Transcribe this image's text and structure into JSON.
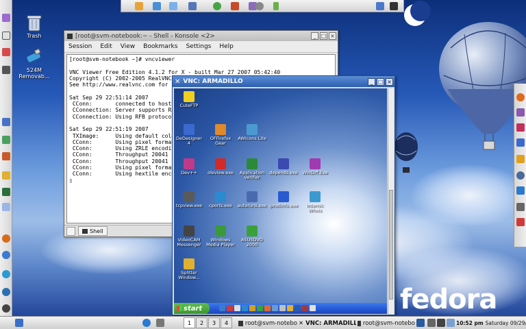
{
  "desktop": {
    "icons": [
      {
        "label": "Trash"
      },
      {
        "label": "524M Removab..."
      }
    ],
    "logo_text": "fedora"
  },
  "konsole": {
    "title": "[root@svm-notebook:~ - Shell - Konsole <2>",
    "menu": [
      "Session",
      "Edit",
      "View",
      "Bookmarks",
      "Settings",
      "Help"
    ],
    "terminal_lines": [
      "[root@svm-notebook ~]# vncviewer",
      "",
      "VNC Viewer Free Edition 4.1.2 for X - built Mar 27 2007 05:42:40",
      "Copyright (C) 2002-2005 RealVNC",
      "See http://www.realvnc.com for i",
      "",
      "Sat Sep 29 22:51:14 2007",
      " CConn:       connected to host",
      " CConnection: Server supports RF",
      " CConnection: Using RFB protocol",
      "",
      "Sat Sep 29 22:51:19 2007",
      " TXImage:     Using default colo",
      " CConn:       Using pixel format",
      " CConn:       Using ZRLE encodin",
      " CConn:       Throughput 20041 k",
      " CConn:       Throughput 20041 k",
      " CConn:       Using pixel format",
      " CConn:       Using hextile enco",
      "▯"
    ],
    "tab_label": "Shell"
  },
  "vnc": {
    "title": "VNC: ARMADILLO",
    "icons": [
      {
        "label": "CuteFTP"
      },
      {
        "label": "DeDesigner 4"
      },
      {
        "label": "OFFirefox Gear"
      },
      {
        "label": "AWIcons Lite"
      },
      {
        "label": "Dev++"
      },
      {
        "label": "oleview.exe"
      },
      {
        "label": "Application Verifier"
      },
      {
        "label": "depends.exe"
      },
      {
        "label": "WinDiff.Exe"
      },
      {
        "label": "tcpview.exe"
      },
      {
        "label": "cports.exe"
      },
      {
        "label": "autoruns.exe"
      },
      {
        "label": "ipnetinfo.exe"
      },
      {
        "label": "Internic Whois"
      },
      {
        "label": "VideoCAM Messenger"
      },
      {
        "label": "Windows Media Player"
      },
      {
        "label": "ASUSDVD 2000"
      },
      {
        "label": "Splitter Window..."
      }
    ],
    "start_label": "start"
  },
  "taskbar": {
    "pager": [
      "1",
      "2",
      "3",
      "4"
    ],
    "tasks": [
      {
        "label": "root@svm-notebo"
      },
      {
        "label": "VNC: ARMADILLO"
      },
      {
        "label": "root@svm-notebo"
      }
    ],
    "clock": "10:52 pm",
    "date": "Saturday 09/29/07"
  }
}
